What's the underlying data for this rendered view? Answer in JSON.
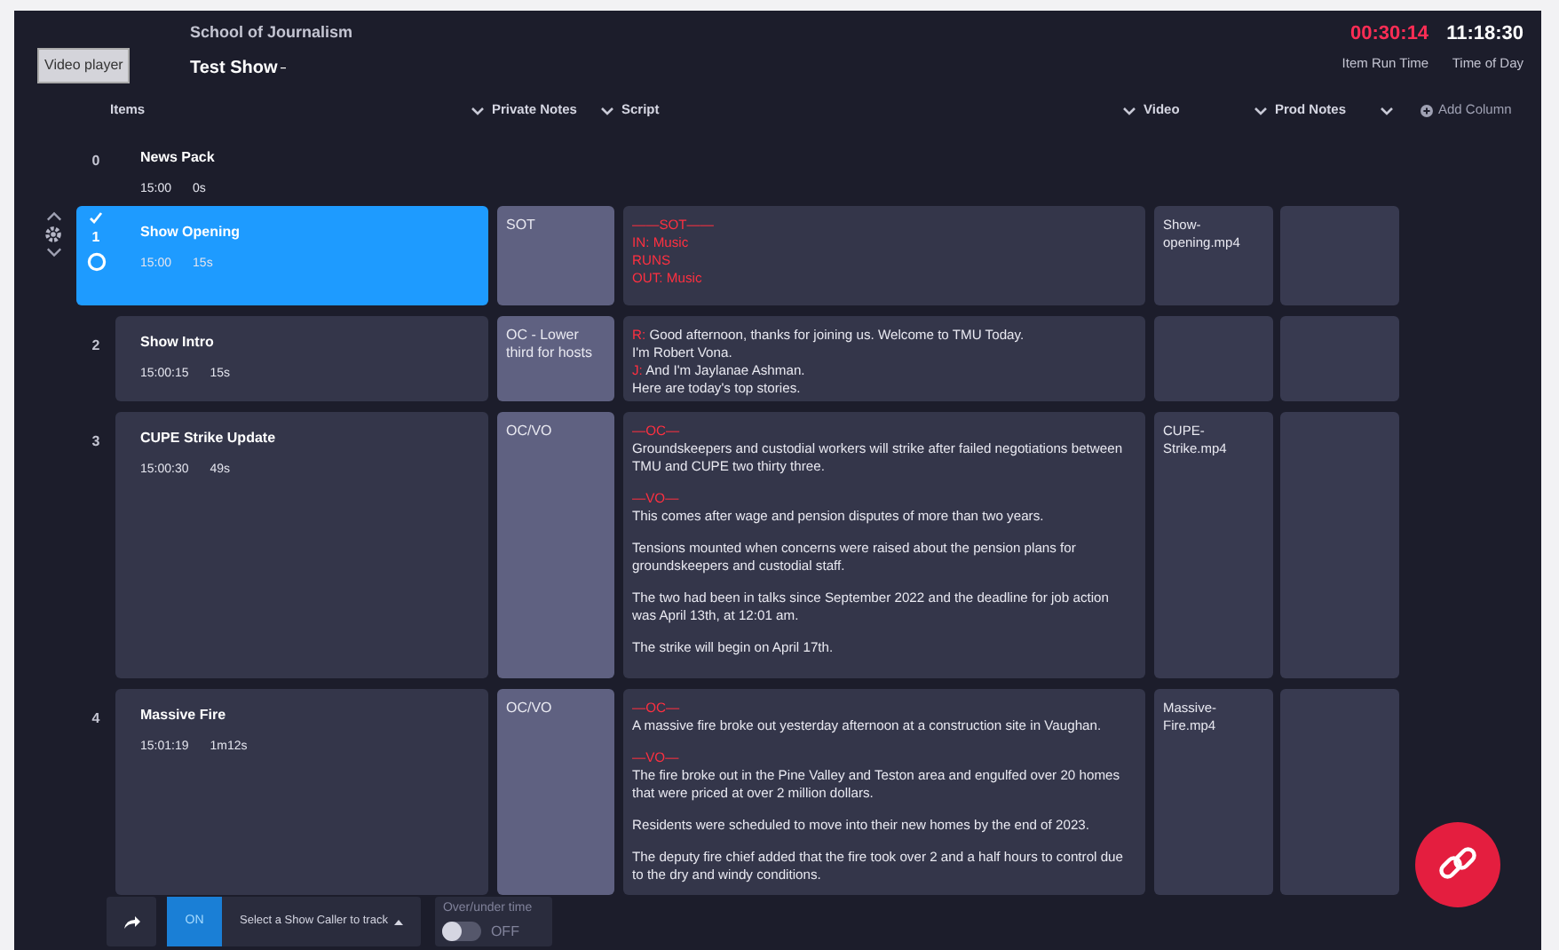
{
  "tooltip": "Video player",
  "header": {
    "organization": "School of Journalism",
    "show_title": "Test Show",
    "item_run_time": "00:30:14",
    "item_run_time_label": "Item Run Time",
    "time_of_day": "11:18:30",
    "time_of_day_label": "Time of Day"
  },
  "columns": [
    {
      "label": "Items",
      "menu": false
    },
    {
      "label": "Private Notes",
      "menu": true
    },
    {
      "label": "Script",
      "menu": true
    },
    {
      "label": "Video",
      "menu": true
    },
    {
      "label": "Prod Notes",
      "menu": true
    }
  ],
  "add_column": "Add Column",
  "rows": [
    {
      "kind": "scrolled",
      "number": "0",
      "title": "News Pack",
      "start": "15:00",
      "duration": "0s",
      "selected": false
    },
    {
      "kind": "item",
      "number": "1",
      "title": "Show Opening",
      "start": "15:00",
      "duration": "15s",
      "selected": true,
      "private_note": "SOT",
      "video": "Show-opening.mp4",
      "script": [
        {
          "kind": "cue",
          "text": "——SOT——"
        },
        {
          "kind": "cue",
          "text": "IN: Music"
        },
        {
          "kind": "cue",
          "text": "RUNS"
        },
        {
          "kind": "cue",
          "text": "OUT: Music"
        }
      ]
    },
    {
      "kind": "item",
      "number": "2",
      "title": "Show Intro",
      "start": "15:00:15",
      "duration": "15s",
      "selected": false,
      "private_note": "OC - Lower third for hosts",
      "script": [
        {
          "kind": "line",
          "speaker": "R:",
          "text": "Good afternoon, thanks for joining us. Welcome to TMU Today."
        },
        {
          "kind": "line",
          "text": "I'm Robert Vona."
        },
        {
          "kind": "line",
          "speaker": "J:",
          "text": "And I'm Jaylanae Ashman."
        },
        {
          "kind": "line",
          "text": "Here are today's top stories."
        }
      ]
    },
    {
      "kind": "item",
      "number": "3",
      "title": "CUPE Strike Update",
      "start": "15:00:30",
      "duration": "49s",
      "selected": false,
      "private_note": "OC/VO",
      "video": "CUPE-Strike.mp4",
      "script": [
        {
          "kind": "cue",
          "text": "—OC—"
        },
        {
          "kind": "para",
          "text": "Groundskeepers and custodial workers will strike after failed negotiations between TMU and CUPE two thirty three."
        },
        {
          "kind": "cue",
          "text": "—VO—"
        },
        {
          "kind": "para",
          "text": "This comes after wage and pension disputes of more than two years."
        },
        {
          "kind": "para",
          "text": "Tensions mounted when concerns were raised about the pension plans for groundskeepers and custodial staff."
        },
        {
          "kind": "para",
          "text": "The two had been in talks since September 2022 and the deadline for job action was April 13th, at 12:01 am."
        },
        {
          "kind": "para",
          "text": "The strike will begin on April 17th."
        }
      ]
    },
    {
      "kind": "item",
      "number": "4",
      "title": "Massive Fire",
      "start": "15:01:19",
      "duration": "1m12s",
      "selected": false,
      "private_note": "OC/VO",
      "video": "Massive-Fire.mp4",
      "script": [
        {
          "kind": "cue",
          "text": "—OC—"
        },
        {
          "kind": "para",
          "text": "A massive fire broke out yesterday afternoon at a construction site in Vaughan."
        },
        {
          "kind": "cue",
          "text": "—VO—"
        },
        {
          "kind": "para",
          "text": "The fire broke out in the Pine Valley and Teston area and engulfed over 20 homes that were priced at over 2 million dollars."
        },
        {
          "kind": "para",
          "text": "Residents were scheduled to move into their new homes by the end of 2023."
        },
        {
          "kind": "para",
          "text": "The deputy fire chief added that the fire took over 2 and a half hours to control due to the dry and windy conditions."
        }
      ]
    }
  ],
  "footer": {
    "tracking_on": true,
    "tracking_label": "ON",
    "show_caller_prompt": "Select a Show Caller to track",
    "over_under_label": "Over/under time",
    "over_under_on": false,
    "over_under_state": "OFF"
  }
}
